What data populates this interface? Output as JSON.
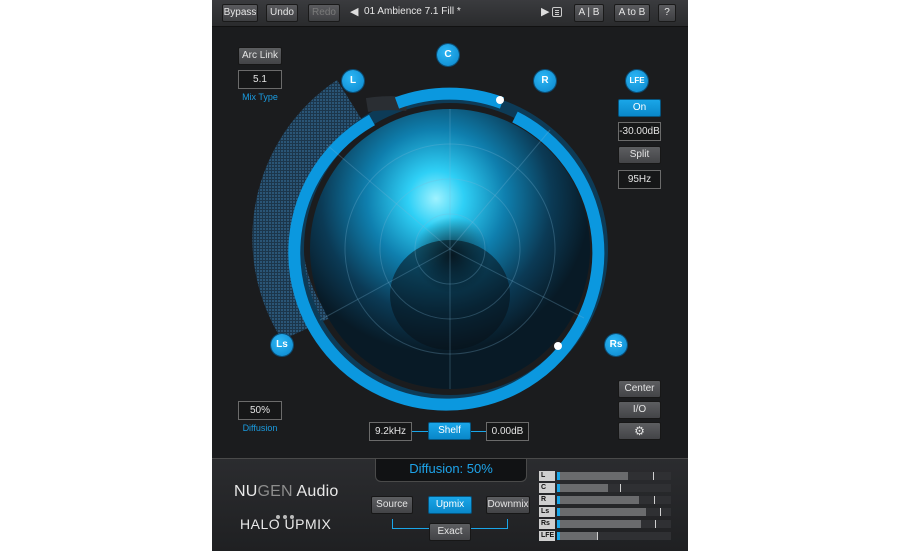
{
  "toolbar": {
    "bypass": "Bypass",
    "undo": "Undo",
    "redo": "Redo",
    "preset_name": "01 Ambience 7.1 Fill *",
    "ab": "A | B",
    "a_to_b": "A to B",
    "help": "?"
  },
  "left_panel": {
    "arc_link": "Arc Link",
    "mix_type_value": "5.1",
    "mix_type_label": "Mix Type",
    "diffusion_value": "50%",
    "diffusion_label": "Diffusion"
  },
  "speakers": {
    "center": "C",
    "left": "L",
    "right": "R",
    "left_surround": "Ls",
    "right_surround": "Rs",
    "lfe": "LFE"
  },
  "lfe_panel": {
    "on": "On",
    "gain": "-30.00dB",
    "split": "Split",
    "frequency": "95Hz"
  },
  "right_buttons": {
    "center": "Center",
    "io": "I/O",
    "settings_icon": "gear-icon"
  },
  "shelf": {
    "frequency": "9.2kHz",
    "label": "Shelf",
    "gain": "0.00dB"
  },
  "bottom": {
    "diffusion_readout": "Diffusion: 50%",
    "logo_nu": "NU",
    "logo_gen": "GEN",
    "logo_audio": " Audio",
    "product": "HALO  UPMIX",
    "source": "Source",
    "upmix": "Upmix",
    "downmix": "Downmix",
    "exact": "Exact"
  },
  "meters": [
    {
      "label": "L",
      "level": 0.62,
      "peak": 0.84
    },
    {
      "label": "C",
      "level": 0.45,
      "peak": 0.55
    },
    {
      "label": "R",
      "level": 0.72,
      "peak": 0.85
    },
    {
      "label": "Ls",
      "level": 0.78,
      "peak": 0.9
    },
    {
      "label": "Rs",
      "level": 0.74,
      "peak": 0.86
    },
    {
      "label": "LFE",
      "level": 0.35,
      "peak": 0.35
    }
  ],
  "colors": {
    "accent": "#1aa6e8",
    "background": "#1b1c1e"
  }
}
